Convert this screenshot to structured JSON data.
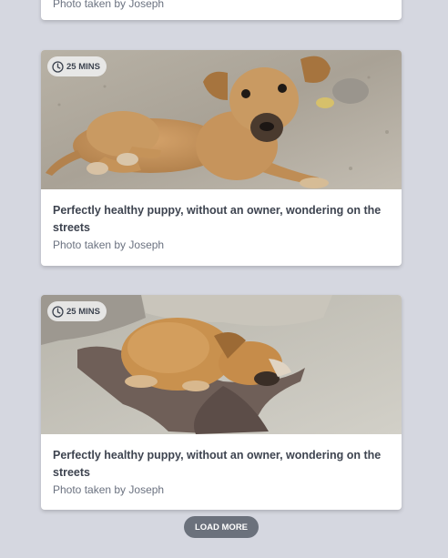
{
  "cards": [
    {
      "subtitle": "Photo taken by Joseph"
    },
    {
      "badge": "25 MINS",
      "title": "Perfectly healthy puppy, without an owner, wondering on the streets",
      "subtitle": "Photo taken by Joseph",
      "image": "puppy lying on sand"
    },
    {
      "badge": "25 MINS",
      "title": "Perfectly healthy puppy, without an owner, wondering on the streets",
      "subtitle": "Photo taken by Joseph",
      "image": "puppy sleeping on blanket"
    }
  ],
  "load_more_label": "LOAD MORE",
  "colors": {
    "background": "#d5d7e0",
    "card": "#ffffff",
    "button": "#6b717c",
    "title_text": "#3e4450",
    "sub_text": "#6b7280"
  },
  "icons": [
    "clock-icon"
  ]
}
